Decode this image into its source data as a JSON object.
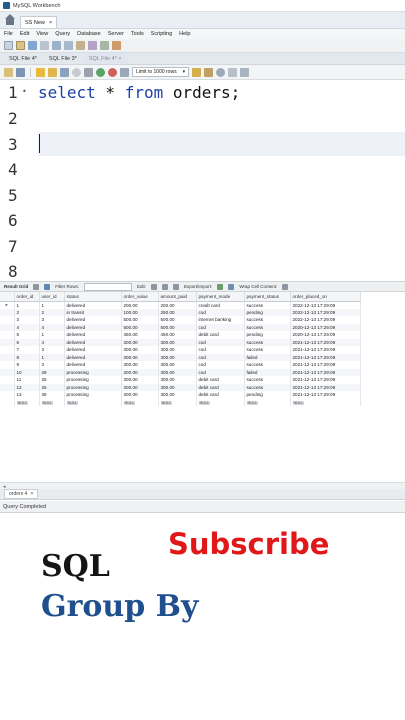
{
  "window": {
    "title": "MySQL Workbench"
  },
  "connection_tab": {
    "label": "SS New",
    "close": "×"
  },
  "menu": [
    "File",
    "Edit",
    "View",
    "Query",
    "Database",
    "Server",
    "Tools",
    "Scripting",
    "Help"
  ],
  "file_tabs": [
    {
      "label": "SQL File 4*",
      "active": false
    },
    {
      "label": "SQL File 3*",
      "active": false
    },
    {
      "label": "SQL File 4* ×",
      "active": true
    }
  ],
  "query_toolbar": {
    "limit_label": "Limit to 1000 rows",
    "limit_arrow": "▾"
  },
  "editor": {
    "line_numbers": [
      "1",
      "2",
      "3",
      "4",
      "5",
      "6",
      "7",
      "8"
    ],
    "fold_marker": "•",
    "code": {
      "kw1": "select",
      "mid": " * ",
      "kw2": "from",
      "rest": " orders;"
    }
  },
  "result_bar": {
    "result_grid": "Result Grid",
    "filter_rows": "Filter Rows:",
    "edit": "Edit:",
    "export_import": "Export/Import:",
    "wrap": "Wrap Cell Content:"
  },
  "grid": {
    "columns": [
      "order_id",
      "user_id",
      "status",
      "order_value",
      "amount_paid",
      "payment_mode",
      "payment_status",
      "order_placed_on"
    ],
    "rows": [
      [
        "1",
        "1",
        "delivered",
        "200.00",
        "200.00",
        "credit card",
        "success",
        "2022-12-13 17:29:09"
      ],
      [
        "2",
        "2",
        "in transit",
        "100.00",
        "250.00",
        "cod",
        "pending",
        "2022-12-13 17:29:09"
      ],
      [
        "3",
        "3",
        "delivered",
        "500.00",
        "500.00",
        "internet banking",
        "success",
        "2022-12-13 17:29:09"
      ],
      [
        "4",
        "4",
        "delivered",
        "500.00",
        "500.00",
        "cod",
        "success",
        "2020-12-13 17:29:09"
      ],
      [
        "5",
        "1",
        "delivered",
        "450.00",
        "450.00",
        "debit card",
        "pending",
        "2020-12-13 17:29:09"
      ],
      [
        "6",
        "4",
        "delivered",
        "300.00",
        "300.00",
        "cod",
        "success",
        "2021-12-13 17:29:09"
      ],
      [
        "7",
        "3",
        "delivered",
        "300.00",
        "300.00",
        "cod",
        "success",
        "2021-12-13 17:29:09"
      ],
      [
        "8",
        "1",
        "delivered",
        "300.00",
        "300.00",
        "cod",
        "failed",
        "2021-12-13 17:29:09"
      ],
      [
        "9",
        "3",
        "delivered",
        "300.00",
        "300.00",
        "cod",
        "success",
        "2021-12-13 17:29:09"
      ],
      [
        "10",
        "28",
        "processing",
        "300.00",
        "300.00",
        "cod",
        "failed",
        "2021-12-13 17:29:09"
      ],
      [
        "11",
        "25",
        "processing",
        "300.00",
        "300.00",
        "debit card",
        "success",
        "2021-12-13 17:29:09"
      ],
      [
        "12",
        "25",
        "processing",
        "300.00",
        "300.00",
        "debit card",
        "success",
        "2021-12-13 17:29:09"
      ],
      [
        "13",
        "36",
        "processing",
        "300.00",
        "300.00",
        "debit card",
        "pending",
        "2021-12-13 17:29:09"
      ]
    ],
    "null_text": "NULL"
  },
  "output_tab": {
    "label": "orders 4",
    "close": "×"
  },
  "status": {
    "text": "Query Completed"
  },
  "overlay": {
    "subscribe": "Subscribe",
    "line1": "SQL",
    "line2": "Group By"
  },
  "colors": {
    "keyword": "#1c3fa8",
    "subscribe": "#e01818",
    "group_by": "#1f4f8c"
  }
}
